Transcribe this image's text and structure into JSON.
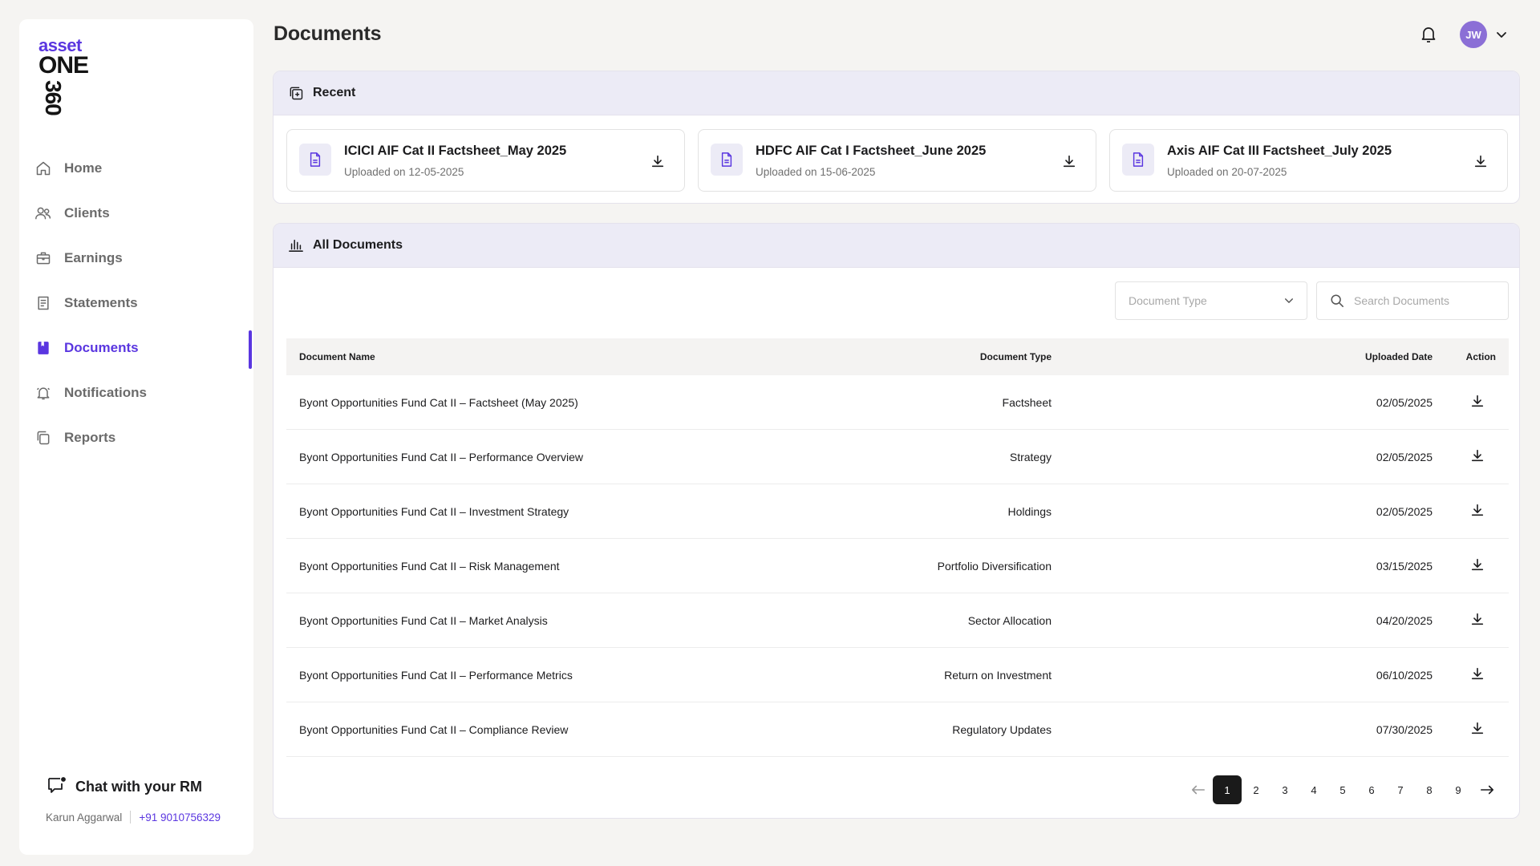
{
  "brand": {
    "line1": "asset",
    "line2": "ONE",
    "line3": "360",
    "accent": "#5a36e0"
  },
  "sidebar": {
    "items": [
      {
        "label": "Home",
        "icon": "home-icon",
        "active": false
      },
      {
        "label": "Clients",
        "icon": "users-icon",
        "active": false
      },
      {
        "label": "Earnings",
        "icon": "briefcase-icon",
        "active": false
      },
      {
        "label": "Statements",
        "icon": "receipt-icon",
        "active": false
      },
      {
        "label": "Documents",
        "icon": "bookmark-book-icon",
        "active": true
      },
      {
        "label": "Notifications",
        "icon": "bell-icon",
        "active": false
      },
      {
        "label": "Reports",
        "icon": "copy-icon",
        "active": false
      }
    ],
    "chat": {
      "title": "Chat with your RM",
      "rm_name": "Karun Aggarwal",
      "rm_phone": "+91 9010756329"
    }
  },
  "header": {
    "title": "Documents",
    "avatar_initials": "JW"
  },
  "recent": {
    "title": "Recent",
    "cards": [
      {
        "name": "ICICI AIF Cat II Factsheet_May 2025",
        "uploaded": "Uploaded on 12-05-2025"
      },
      {
        "name": "HDFC AIF Cat I Factsheet_June 2025",
        "uploaded": "Uploaded on 15-06-2025"
      },
      {
        "name": "Axis AIF Cat III Factsheet_July 2025",
        "uploaded": "Uploaded on 20-07-2025"
      }
    ]
  },
  "all_documents": {
    "title": "All Documents",
    "filter_placeholder": "Document Type",
    "search_placeholder": "Search Documents",
    "columns": {
      "name": "Document Name",
      "type": "Document Type",
      "date": "Uploaded Date",
      "action": "Action"
    },
    "rows": [
      {
        "name": "Byont Opportunities Fund Cat II – Factsheet (May 2025)",
        "type": "Factsheet",
        "date": "02/05/2025"
      },
      {
        "name": "Byont Opportunities Fund Cat II – Performance Overview",
        "type": "Strategy",
        "date": "02/05/2025"
      },
      {
        "name": "Byont Opportunities Fund Cat II – Investment Strategy",
        "type": "Holdings",
        "date": "02/05/2025"
      },
      {
        "name": "Byont Opportunities Fund Cat II – Risk Management",
        "type": "Portfolio Diversification",
        "date": "03/15/2025"
      },
      {
        "name": "Byont Opportunities Fund Cat II – Market Analysis",
        "type": "Sector Allocation",
        "date": "04/20/2025"
      },
      {
        "name": "Byont Opportunities Fund Cat II – Performance Metrics",
        "type": "Return on Investment",
        "date": "06/10/2025"
      },
      {
        "name": "Byont Opportunities Fund Cat II – Compliance Review",
        "type": "Regulatory Updates",
        "date": "07/30/2025"
      }
    ],
    "pages": [
      "1",
      "2",
      "3",
      "4",
      "5",
      "6",
      "7",
      "8",
      "9"
    ],
    "current_page": "1"
  }
}
